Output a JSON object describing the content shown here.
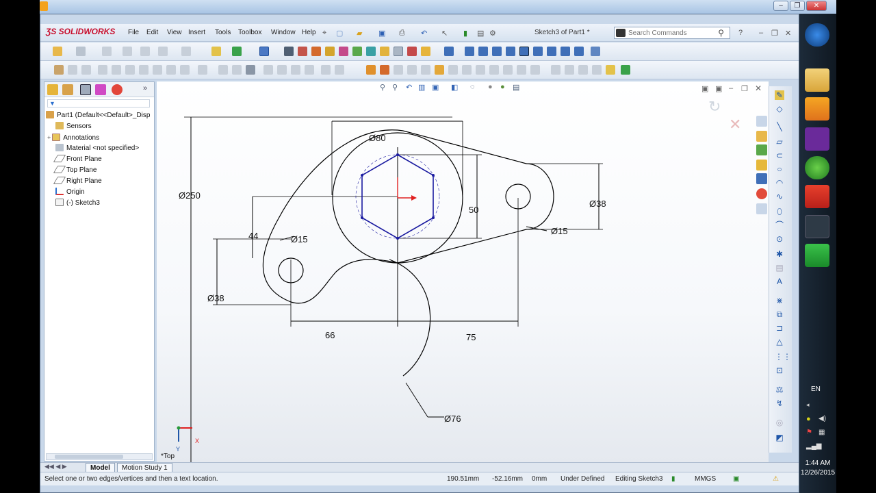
{
  "app": {
    "logo_text": "SOLIDWORKS",
    "window_title": "Sketch3 of Part1 *"
  },
  "menu": [
    "File",
    "Edit",
    "View",
    "Insert",
    "Tools",
    "Toolbox",
    "Window",
    "Help"
  ],
  "search": {
    "placeholder": "Search Commands"
  },
  "tree": {
    "part": "Part1  (Default<<Default>_Disp",
    "items": [
      "Sensors",
      "Annotations",
      "Material <not specified>",
      "Front Plane",
      "Top Plane",
      "Right Plane",
      "Origin",
      "(-) Sketch3"
    ]
  },
  "sketch": {
    "dims": {
      "d250": "Ø250",
      "d80": "Ø80",
      "d50": "50",
      "d38_right": "Ø38",
      "d15_right": "Ø15",
      "d44": "44",
      "d15_left": "Ø15",
      "d38_left": "Ø38",
      "d66": "66",
      "d75": "75",
      "d76": "Ø76"
    },
    "view_label": "*Top",
    "axis_x": "X",
    "axis_y": "Y"
  },
  "bottom_tabs": [
    "Model",
    "Motion Study 1"
  ],
  "status": {
    "message": "Select one or two edges/vertices and then a text location.",
    "x": "190.51mm",
    "y": "-52.16mm",
    "z": "0mm",
    "state": "Under Defined",
    "mode": "Editing Sketch3",
    "units": "MMGS"
  },
  "taskbar": {
    "lang": "EN",
    "time": "1:44 AM",
    "date": "12/26/2015"
  },
  "colors": {
    "sketch_line": "#000000",
    "hexagon": "#1a1aa0",
    "origin_arrow": "#e02020"
  }
}
